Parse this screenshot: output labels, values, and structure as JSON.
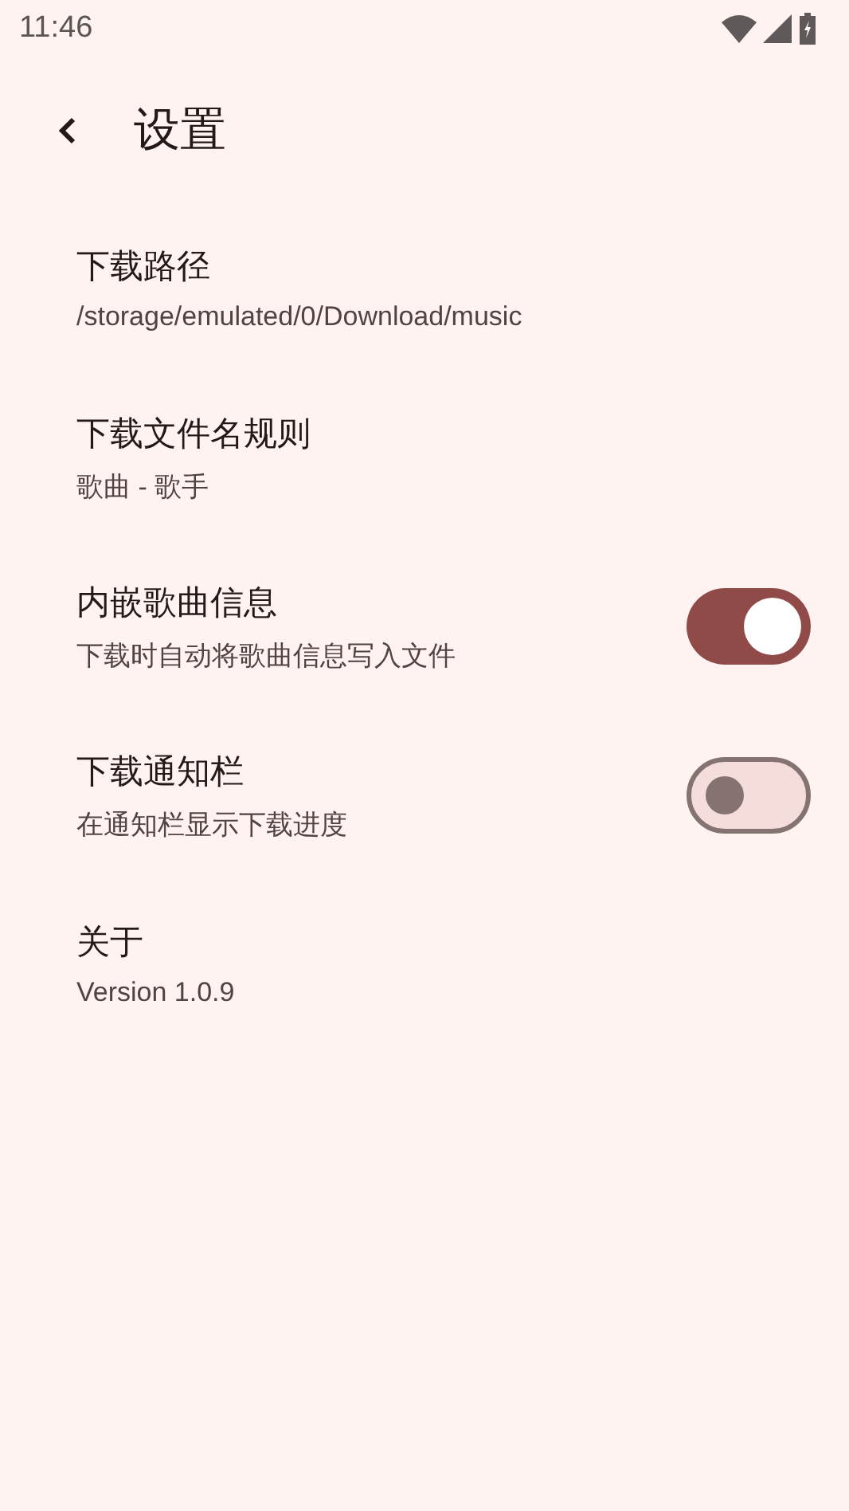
{
  "status_bar": {
    "time": "11:46"
  },
  "toolbar": {
    "title": "设置"
  },
  "settings": [
    {
      "kind": "text",
      "title": "下载路径",
      "subtitle": "/storage/emulated/0/Download/music"
    },
    {
      "kind": "text",
      "title": "下载文件名规则",
      "subtitle": "歌曲 - 歌手"
    },
    {
      "kind": "switch",
      "title": "内嵌歌曲信息",
      "subtitle": "下载时自动将歌曲信息写入文件",
      "on": true
    },
    {
      "kind": "switch",
      "title": "下载通知栏",
      "subtitle": "在通知栏显示下载进度",
      "on": false
    },
    {
      "kind": "text",
      "title": "关于",
      "subtitle": "Version 1.0.9"
    }
  ]
}
